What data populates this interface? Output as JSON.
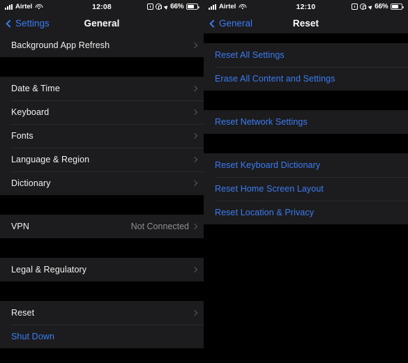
{
  "colors": {
    "accent_blue": "#3c7cf3",
    "row_background": "#1c1c1e",
    "page_background": "#000000",
    "label": "#f2f2f2",
    "secondary_label": "#8e8e93",
    "separator": "#2b2b2d"
  },
  "left_screen": {
    "status_bar": {
      "carrier": "Airtel",
      "time": "12:08",
      "battery_percent": "66%",
      "icons": [
        "cellular-bars-icon",
        "wifi-icon",
        "alarm-clock-icon",
        "rotation-lock-icon",
        "location-arrow-icon",
        "battery-icon"
      ]
    },
    "nav_bar": {
      "back_label": "Settings",
      "title": "General"
    },
    "groups": [
      {
        "rows": [
          {
            "label": "Background App Refresh",
            "value": "",
            "chevron": true,
            "blue": false
          }
        ]
      },
      {
        "rows": [
          {
            "label": "Date & Time",
            "value": "",
            "chevron": true,
            "blue": false
          },
          {
            "label": "Keyboard",
            "value": "",
            "chevron": true,
            "blue": false
          },
          {
            "label": "Fonts",
            "value": "",
            "chevron": true,
            "blue": false
          },
          {
            "label": "Language & Region",
            "value": "",
            "chevron": true,
            "blue": false
          },
          {
            "label": "Dictionary",
            "value": "",
            "chevron": true,
            "blue": false
          }
        ]
      },
      {
        "rows": [
          {
            "label": "VPN",
            "value": "Not Connected",
            "chevron": true,
            "blue": false
          }
        ]
      },
      {
        "rows": [
          {
            "label": "Legal & Regulatory",
            "value": "",
            "chevron": true,
            "blue": false
          }
        ]
      },
      {
        "rows": [
          {
            "label": "Reset",
            "value": "",
            "chevron": true,
            "blue": false
          },
          {
            "label": "Shut Down",
            "value": "",
            "chevron": false,
            "blue": true
          }
        ]
      }
    ]
  },
  "right_screen": {
    "status_bar": {
      "carrier": "Airtel",
      "time": "12:10",
      "battery_percent": "66%",
      "icons": [
        "cellular-bars-icon",
        "wifi-icon",
        "alarm-clock-icon",
        "rotation-lock-icon",
        "location-arrow-icon",
        "battery-icon"
      ]
    },
    "nav_bar": {
      "back_label": "General",
      "title": "Reset"
    },
    "groups": [
      {
        "rows": [
          {
            "label": "Reset All Settings",
            "value": "",
            "chevron": false,
            "blue": true
          },
          {
            "label": "Erase All Content and Settings",
            "value": "",
            "chevron": false,
            "blue": true
          }
        ]
      },
      {
        "rows": [
          {
            "label": "Reset Network Settings",
            "value": "",
            "chevron": false,
            "blue": true
          }
        ]
      },
      {
        "rows": [
          {
            "label": "Reset Keyboard Dictionary",
            "value": "",
            "chevron": false,
            "blue": true
          },
          {
            "label": "Reset Home Screen Layout",
            "value": "",
            "chevron": false,
            "blue": true
          },
          {
            "label": "Reset Location & Privacy",
            "value": "",
            "chevron": false,
            "blue": true
          }
        ]
      }
    ]
  }
}
